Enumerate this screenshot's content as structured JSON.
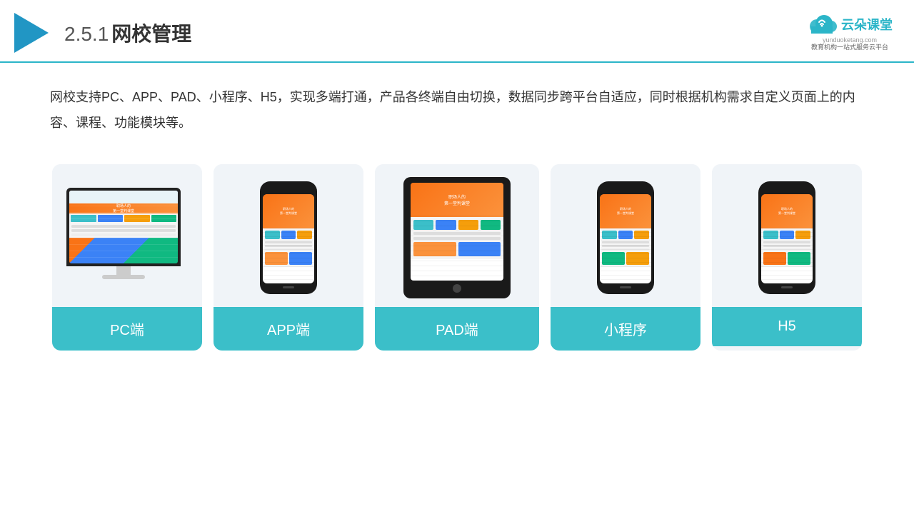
{
  "header": {
    "title_number": "2.5.1",
    "title_text": "网校管理",
    "logo_name": "云朵课堂",
    "logo_url": "yunduoketang.com",
    "logo_tagline": "教育机构一站\n式服务云平台"
  },
  "description": {
    "text": "网校支持PC、APP、PAD、小程序、H5，实现多端打通，产品各终端自由切换，数据同步跨平台自适应，同时根据机构需求自定义页面上的内容、课程、功能模块等。"
  },
  "cards": [
    {
      "id": "pc",
      "label": "PC端"
    },
    {
      "id": "app",
      "label": "APP端"
    },
    {
      "id": "pad",
      "label": "PAD端"
    },
    {
      "id": "miniprogram",
      "label": "小程序"
    },
    {
      "id": "h5",
      "label": "H5"
    }
  ],
  "colors": {
    "accent": "#3bbfc9",
    "header_border": "#2bb5c8",
    "background_card": "#f0f4f8",
    "text_primary": "#333333"
  }
}
